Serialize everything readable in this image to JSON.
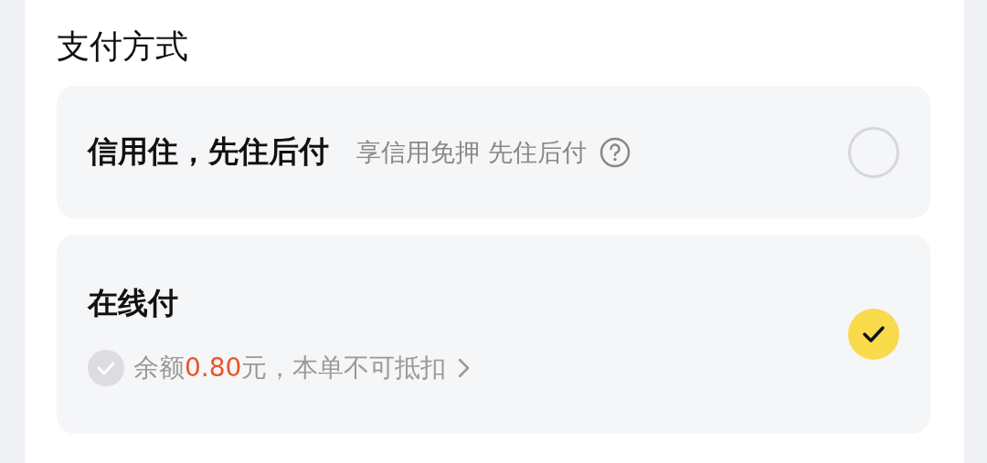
{
  "title": "支付方式",
  "options": [
    {
      "label": "信用住，先住后付",
      "note": "享信用免押 先住后付",
      "selected": false
    },
    {
      "label": "在线付",
      "selected": true,
      "balance": {
        "prefix": "余额",
        "amount": "0.80",
        "suffix": "元，本单不可抵扣",
        "disabled": true
      }
    }
  ]
}
